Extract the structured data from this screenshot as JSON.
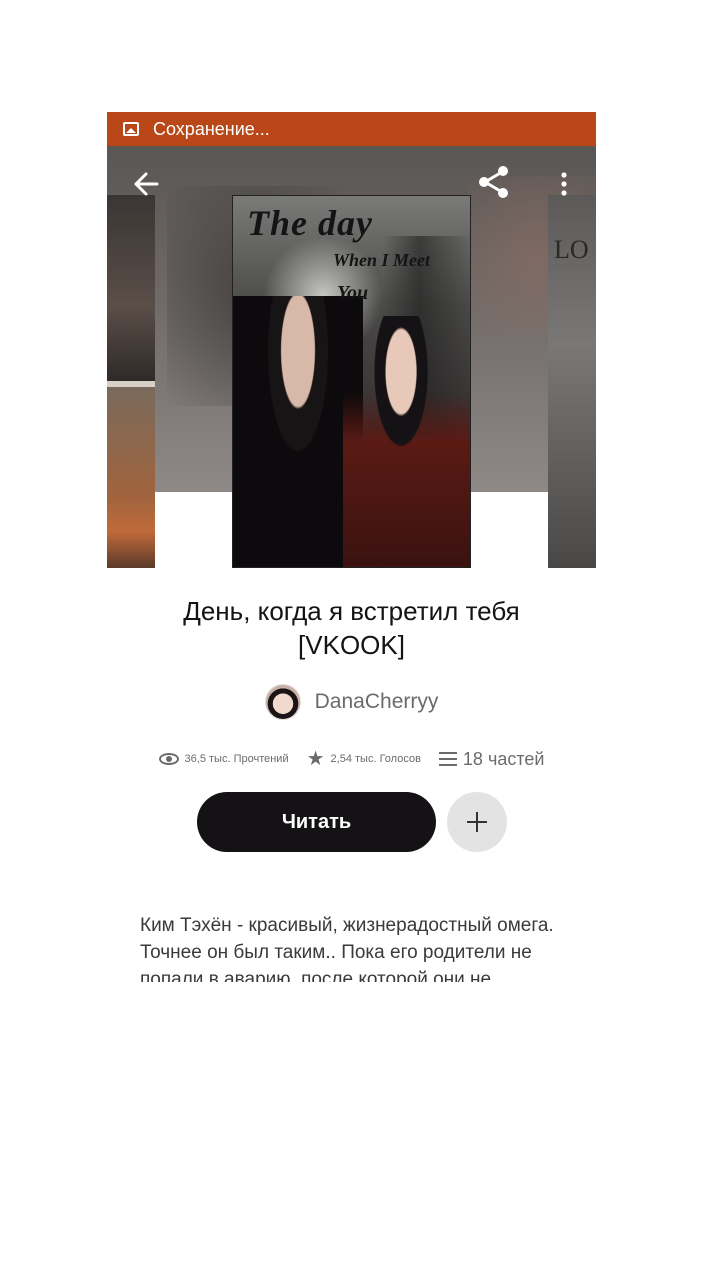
{
  "status_bar": {
    "text": "Сохранение..."
  },
  "toolbar": {
    "back": "back",
    "share": "share",
    "more": "more"
  },
  "side_cover_right": {
    "partial_text": "LO"
  },
  "cover": {
    "line1": "The day",
    "line2": "When I Meet",
    "line3": "You"
  },
  "story": {
    "title": "День, когда я встретил тебя [VKOOK]",
    "author": "DanaCherryy",
    "reads": "36,5 тыс. Прочтений",
    "votes": "2,54 тыс. Голосов",
    "parts": "18 частей",
    "read_button": "Читать",
    "description": "Ким Тэхён - красивый, жизнерадостный омега. Точнее он был таким.. Пока его родители не попали в аварию, после которой они не"
  },
  "icons": {
    "status": "image-icon",
    "back": "arrow-left-icon",
    "share": "share-icon",
    "more": "more-vertical-icon",
    "reads": "eye-icon",
    "votes": "star-icon",
    "parts": "list-icon",
    "add": "plus-icon"
  },
  "colors": {
    "status_bar": "#b94717",
    "read_button": "#141214",
    "add_button": "#e3e3e3",
    "muted_text": "#6b6b6b"
  }
}
